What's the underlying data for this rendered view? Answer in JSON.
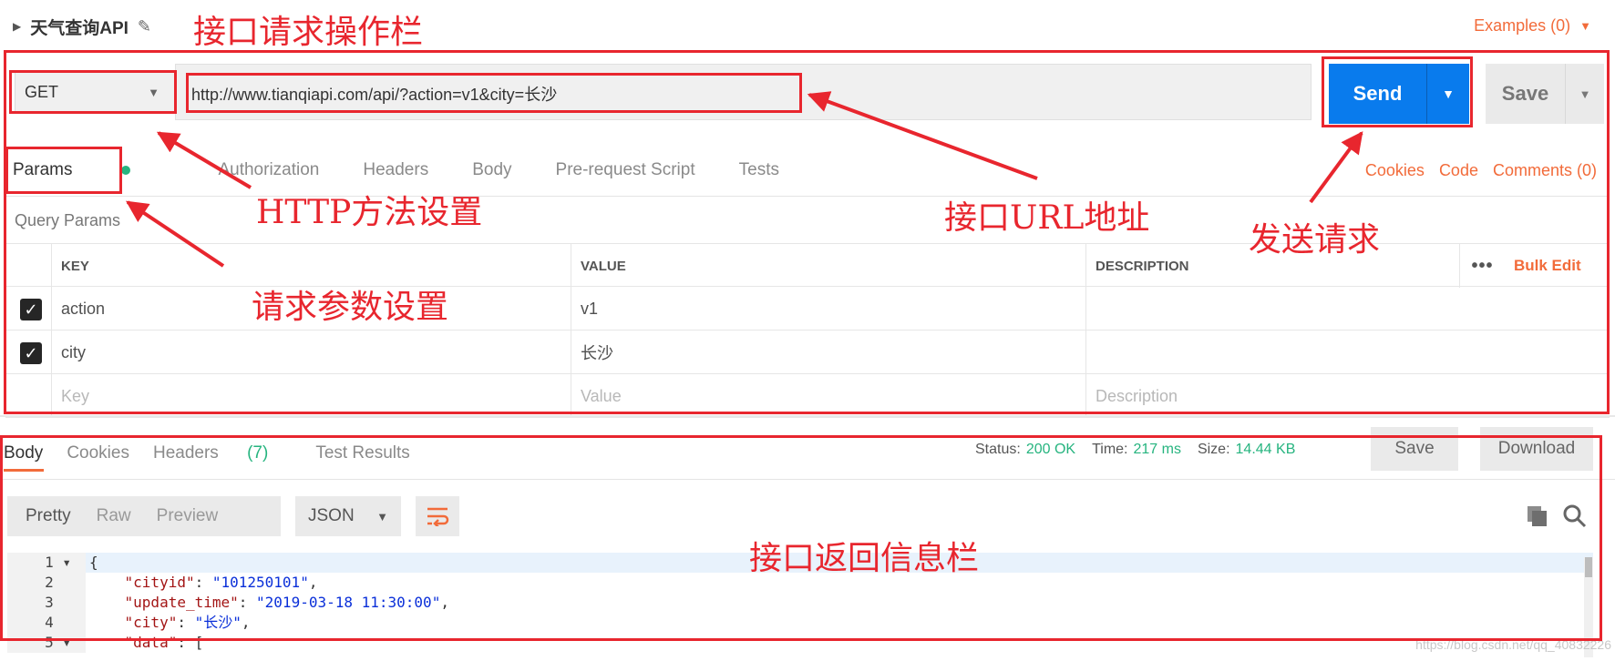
{
  "request": {
    "name": "天气查询API",
    "examples_label": "Examples (0)",
    "method": "GET",
    "url": "http://www.tianqiapi.com/api/?action=v1&city=长沙",
    "send_label": "Send",
    "save_label": "Save"
  },
  "tabs": {
    "params": "Params",
    "authorization": "Authorization",
    "headers": "Headers",
    "body": "Body",
    "prerequest": "Pre-request Script",
    "tests": "Tests",
    "cookies": "Cookies",
    "code": "Code",
    "comments": "Comments (0)"
  },
  "query_params": {
    "label": "Query Params",
    "columns": {
      "key": "KEY",
      "value": "VALUE",
      "description": "DESCRIPTION"
    },
    "dots": "•••",
    "bulk_edit": "Bulk Edit",
    "rows": [
      {
        "key": "action",
        "value": "v1",
        "checked": true
      },
      {
        "key": "city",
        "value": "长沙",
        "checked": true
      }
    ],
    "placeholder": {
      "key": "Key",
      "value": "Value",
      "description": "Description"
    }
  },
  "response": {
    "tabs": {
      "body": "Body",
      "cookies": "Cookies",
      "headers": "Headers",
      "headers_count": "(7)",
      "test_results": "Test Results"
    },
    "status_label": "Status:",
    "status_value": "200 OK",
    "time_label": "Time:",
    "time_value": "217 ms",
    "size_label": "Size:",
    "size_value": "14.44 KB",
    "save_label": "Save",
    "download_label": "Download",
    "view_modes": [
      "Pretty",
      "Raw",
      "Preview"
    ],
    "format": "JSON",
    "code_lines": [
      {
        "n": "1",
        "fold": "▾",
        "key": "",
        "sep": "",
        "val": "",
        "raw": "{"
      },
      {
        "n": "2",
        "fold": "",
        "key": "\"cityid\"",
        "sep": ": ",
        "val": "\"101250101\"",
        "raw": ","
      },
      {
        "n": "3",
        "fold": "",
        "key": "\"update_time\"",
        "sep": ": ",
        "val": "\"2019-03-18 11:30:00\"",
        "raw": ","
      },
      {
        "n": "4",
        "fold": "",
        "key": "\"city\"",
        "sep": ": ",
        "val": "\"长沙\"",
        "raw": ","
      },
      {
        "n": "5",
        "fold": "▾",
        "key": "\"data\"",
        "sep": ": ",
        "val": "",
        "raw": "["
      }
    ],
    "watermark": "https://blog.csdn.net/qq_40832226"
  },
  "annotations": {
    "toolbar": "接口请求操作栏",
    "method": "HTTP方法设置",
    "url": "接口URL地址",
    "send": "发送请求",
    "params": "请求参数设置",
    "response": "接口返回信息栏"
  },
  "colors": {
    "accent": "#f26b3a",
    "send": "#097bed",
    "success": "#26b47f",
    "annotation": "#e8262e"
  }
}
